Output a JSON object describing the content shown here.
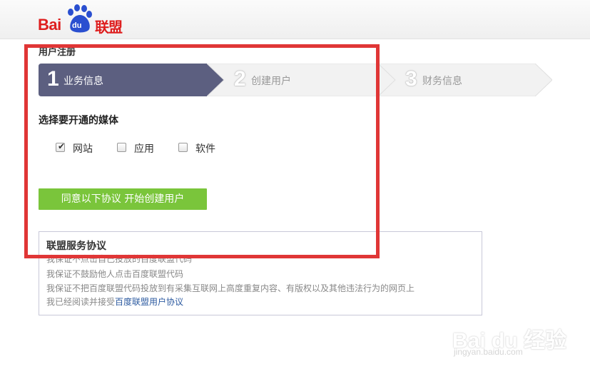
{
  "logo": {
    "bai": "Bai",
    "du": "du",
    "lianmeng": "联盟",
    "color": "#de1e1e"
  },
  "registration_title": "用户注册",
  "steps": [
    {
      "number": "1",
      "label": "业务信息",
      "active": true
    },
    {
      "number": "2",
      "label": "创建用户",
      "active": false
    },
    {
      "number": "3",
      "label": "财务信息",
      "active": false
    }
  ],
  "media_section": {
    "title": "选择要开通的媒体",
    "options": [
      {
        "label": "网站",
        "checked": true
      },
      {
        "label": "应用",
        "checked": false
      },
      {
        "label": "软件",
        "checked": false
      }
    ]
  },
  "agree_button": {
    "label": "同意以下协议 开始创建用户",
    "color": "#7ac53b"
  },
  "agreement": {
    "title": "联盟服务协议",
    "lines": [
      "我保证不点击自己投放的百度联盟代码",
      "我保证不鼓励他人点击百度联盟代码",
      "我保证不把百度联盟代码投放到有采集互联网上高度重复内容、有版权以及其他违法行为的网页上"
    ],
    "read_prefix": "我已经阅读并接受",
    "read_link": "百度联盟用户协议"
  },
  "watermark": {
    "text": "Bai du 经验",
    "url": "jingyan.baidu.com"
  },
  "colors": {
    "active_step": "#5c5f80",
    "highlight": "#e03636",
    "link": "#2c5aa0"
  }
}
